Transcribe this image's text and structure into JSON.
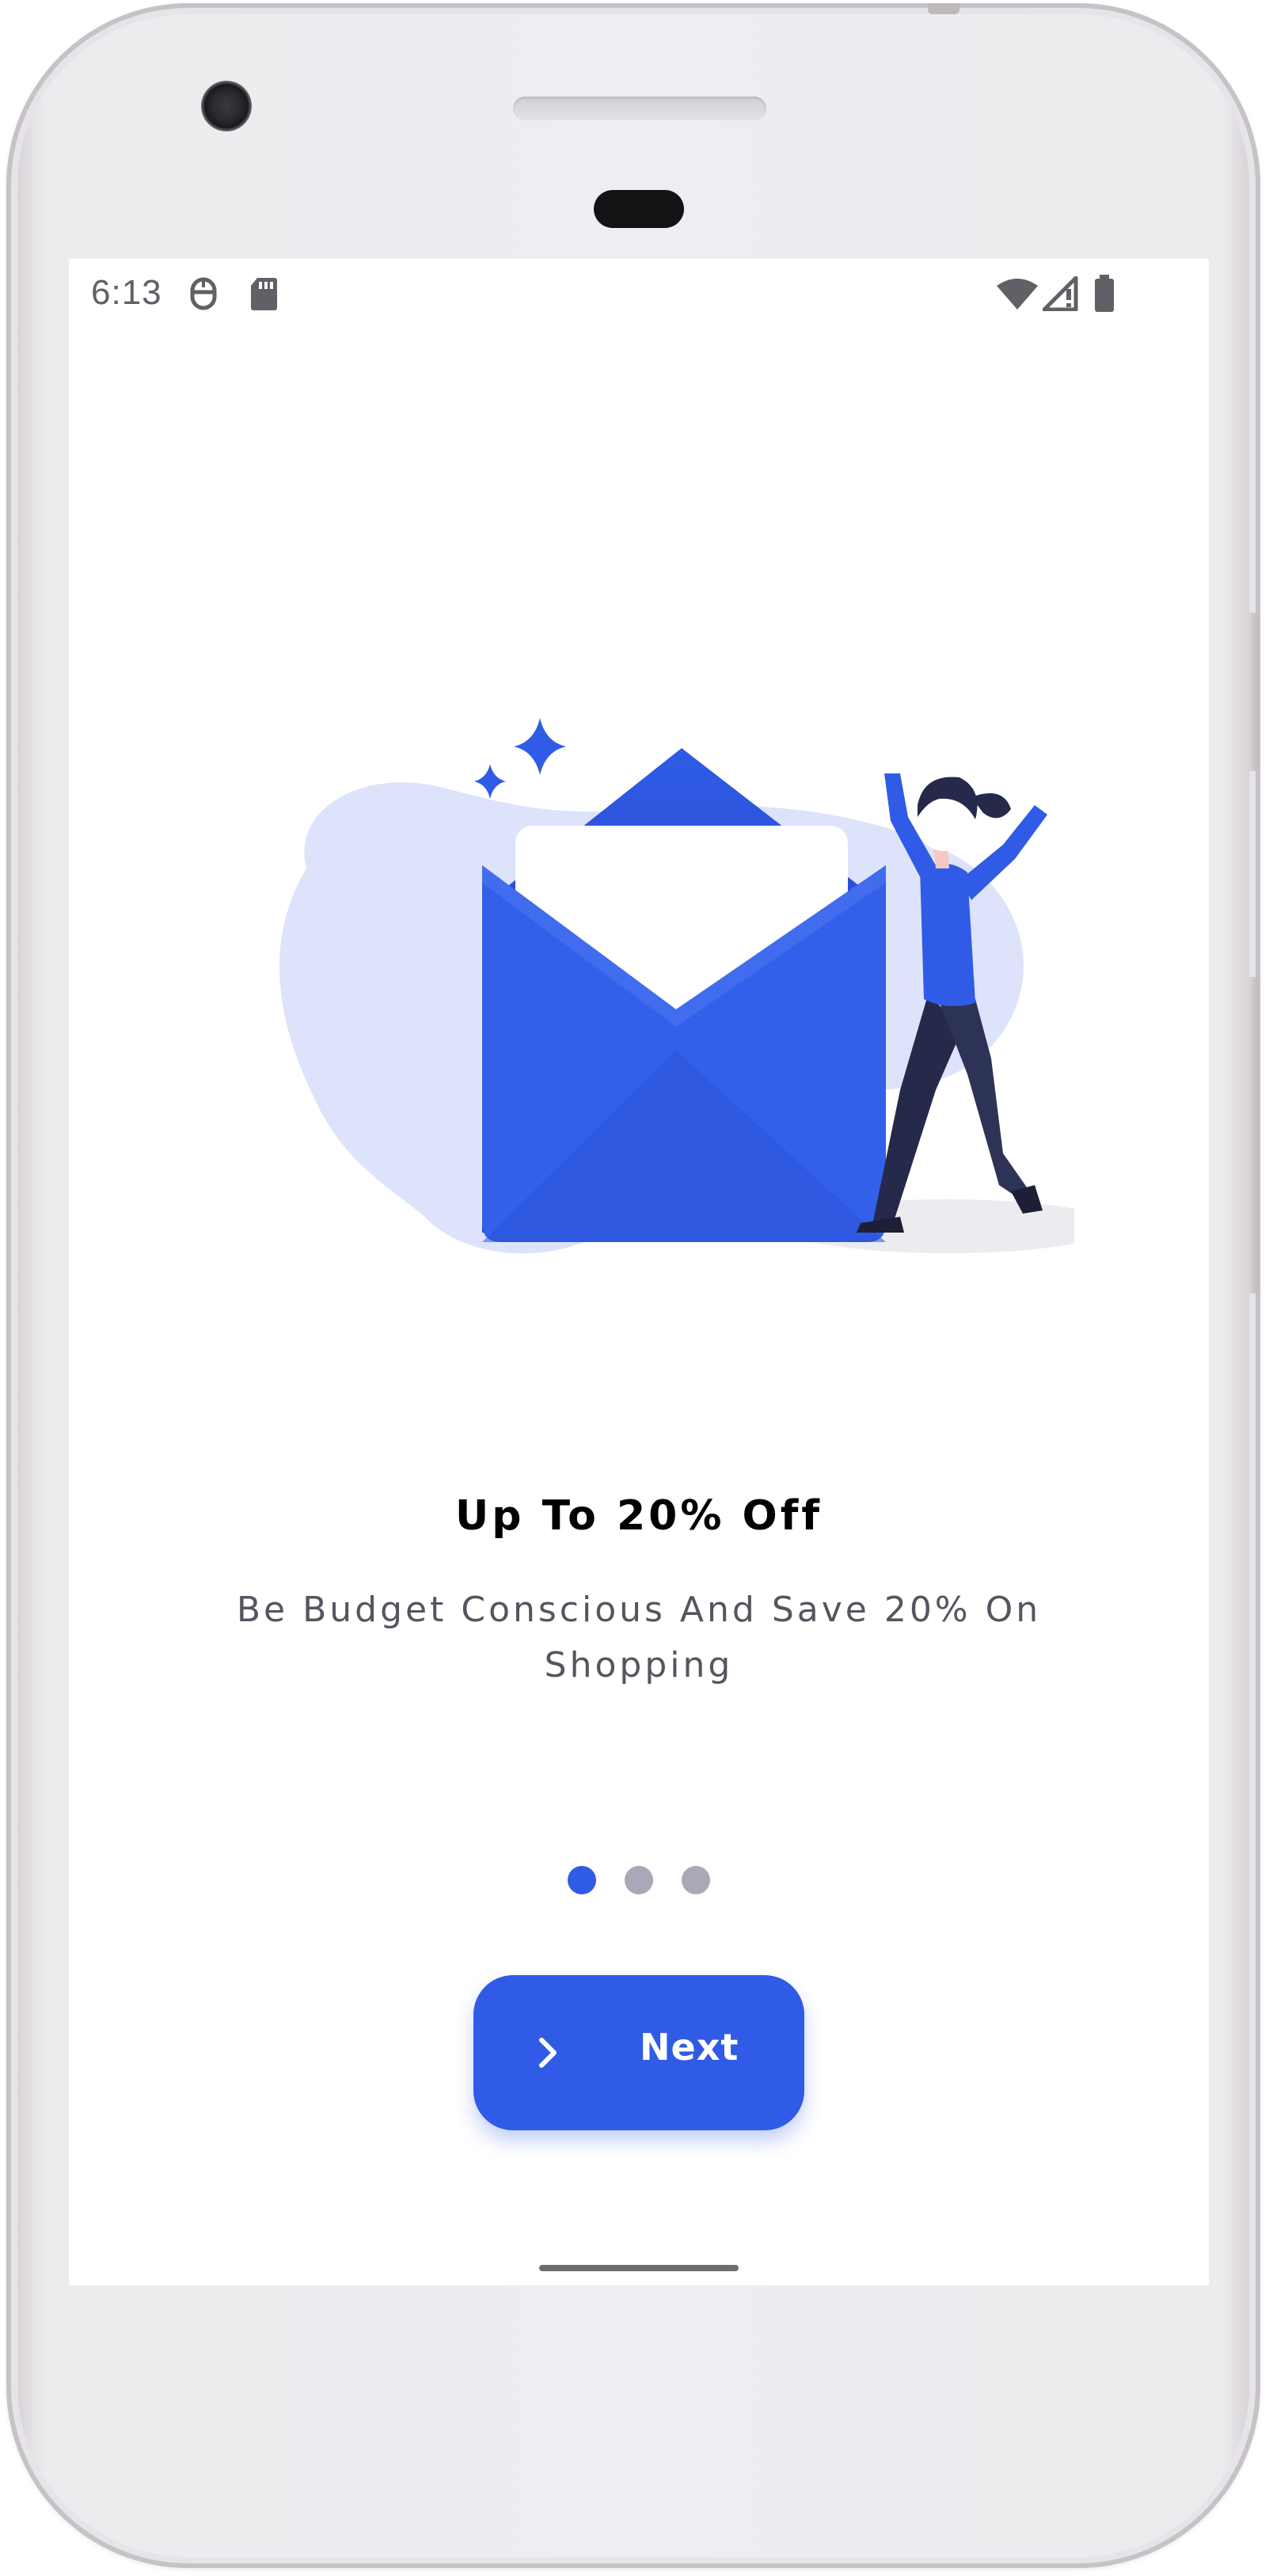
{
  "status_bar": {
    "time": "6:13",
    "icons": [
      "app-notification-icon",
      "sd-card-icon",
      "wifi-icon",
      "signal-icon",
      "battery-icon"
    ]
  },
  "onboarding": {
    "title": "Up To 20% Off",
    "subtitle": "Be Budget Conscious And Save 20% On Shopping",
    "page_indicator": {
      "total": 3,
      "active": 1
    },
    "next_button": {
      "label": "Next",
      "icon": "chevron-right-icon"
    },
    "illustration": "open-envelope-celebrating-woman"
  },
  "colors": {
    "accent": "#2f5be6",
    "accent_dark": "#2543c4",
    "blob": "#dde3fa",
    "dot_inactive": "#a8a8b6",
    "title": "#000000",
    "subtitle": "#55555f"
  }
}
